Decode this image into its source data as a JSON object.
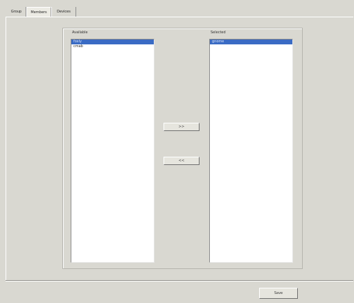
{
  "tabs": {
    "group": "Group",
    "members": "Members",
    "devices": "Devices"
  },
  "available": {
    "caption": "Available",
    "items": [
      "foxly",
      "cmab"
    ]
  },
  "selected": {
    "caption": "Selected",
    "items": [
      "gnome"
    ]
  },
  "buttons": {
    "add": ">>",
    "remove": "<<",
    "save": "Save"
  },
  "colors": {
    "selection": "#3a6bc4",
    "background": "#d9d8d1"
  }
}
